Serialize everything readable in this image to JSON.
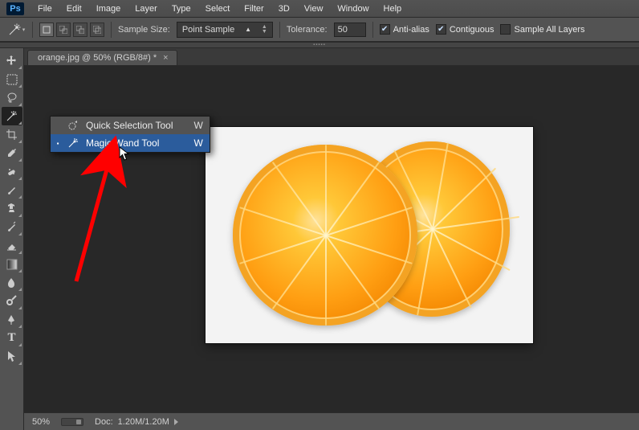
{
  "app": {
    "logo": "Ps"
  },
  "menus": [
    "File",
    "Edit",
    "Image",
    "Layer",
    "Type",
    "Select",
    "Filter",
    "3D",
    "View",
    "Window",
    "Help"
  ],
  "options": {
    "sample_size_label": "Sample Size:",
    "sample_size_value": "Point Sample",
    "tolerance_label": "Tolerance:",
    "tolerance_value": "50",
    "anti_alias": "Anti-alias",
    "contiguous": "Contiguous",
    "sample_all": "Sample All Layers"
  },
  "document": {
    "tab_title": "orange.jpg @ 50% (RGB/8#) *"
  },
  "flyout": {
    "items": [
      {
        "label": "Quick Selection Tool",
        "shortcut": "W",
        "selected": false
      },
      {
        "label": "Magic Wand Tool",
        "shortcut": "W",
        "selected": true
      }
    ]
  },
  "status": {
    "zoom": "50%",
    "doc_label": "Doc:",
    "doc_value": "1.20M/1.20M"
  }
}
